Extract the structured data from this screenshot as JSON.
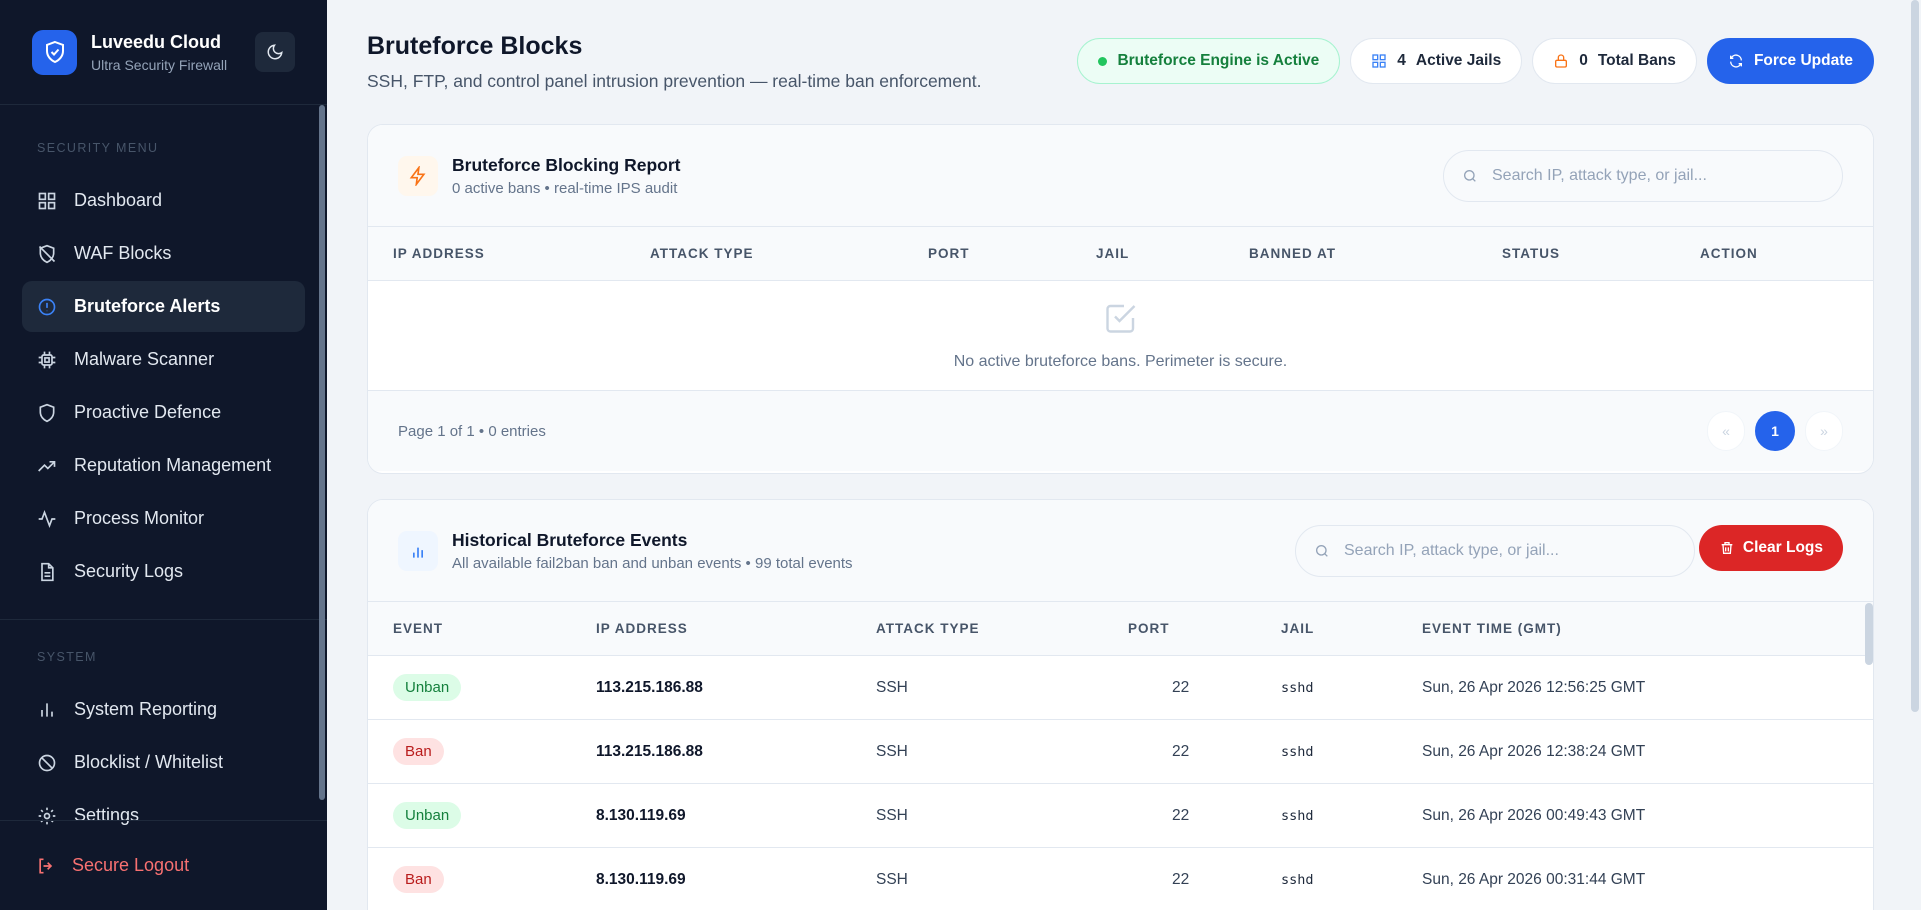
{
  "sidebar": {
    "brand_title": "Luveedu Cloud",
    "brand_sub": "Ultra Security Firewall",
    "security_label": "SECURITY MENU",
    "security_items": [
      {
        "label": "Dashboard",
        "icon": "grid-icon"
      },
      {
        "label": "WAF Blocks",
        "icon": "shield-off-icon"
      },
      {
        "label": "Bruteforce Alerts",
        "icon": "alert-circle-icon",
        "active": true
      },
      {
        "label": "Malware Scanner",
        "icon": "cpu-icon"
      },
      {
        "label": "Proactive Defence",
        "icon": "shield-icon"
      },
      {
        "label": "Reputation Management",
        "icon": "trending-up-icon"
      },
      {
        "label": "Process Monitor",
        "icon": "activity-icon"
      },
      {
        "label": "Security Logs",
        "icon": "file-text-icon"
      }
    ],
    "system_label": "SYSTEM",
    "system_items": [
      {
        "label": "System Reporting",
        "icon": "bar-chart-icon"
      },
      {
        "label": "Blocklist / Whitelist",
        "icon": "ban-icon"
      },
      {
        "label": "Settings",
        "icon": "gear-icon"
      }
    ],
    "logout_label": "Secure Logout"
  },
  "header": {
    "title": "Bruteforce Blocks",
    "subtitle": "SSH, FTP, and control panel intrusion prevention — real-time ban enforcement.",
    "engine_status": "Bruteforce Engine is Active",
    "active_jails_count": "4",
    "active_jails_label": "Active Jails",
    "total_bans_count": "0",
    "total_bans_label": "Total Bans",
    "force_update_label": "Force Update"
  },
  "report": {
    "title": "Bruteforce Blocking Report",
    "subtitle": "0 active bans • real-time IPS audit",
    "search_placeholder": "Search IP, attack type, or jail...",
    "columns": [
      "IP ADDRESS",
      "ATTACK TYPE",
      "PORT",
      "JAIL",
      "BANNED AT",
      "STATUS",
      "ACTION"
    ],
    "empty_text": "No active bruteforce bans. Perimeter is secure.",
    "footer_text": "Page 1 of 1 • 0 entries",
    "pager": {
      "prev": "«",
      "current": "1",
      "next": "»"
    }
  },
  "history": {
    "title": "Historical Bruteforce Events",
    "subtitle": "All available fail2ban ban and unban events • 99 total events",
    "search_placeholder": "Search IP, attack type, or jail...",
    "clear_label": "Clear Logs",
    "columns": [
      "EVENT",
      "IP ADDRESS",
      "ATTACK TYPE",
      "PORT",
      "JAIL",
      "EVENT TIME (GMT)"
    ],
    "rows": [
      {
        "event": "Unban",
        "ip": "113.215.186.88",
        "type": "SSH",
        "port": "22",
        "jail": "sshd",
        "time": "Sun, 26 Apr 2026 12:56:25 GMT"
      },
      {
        "event": "Ban",
        "ip": "113.215.186.88",
        "type": "SSH",
        "port": "22",
        "jail": "sshd",
        "time": "Sun, 26 Apr 2026 12:38:24 GMT"
      },
      {
        "event": "Unban",
        "ip": "8.130.119.69",
        "type": "SSH",
        "port": "22",
        "jail": "sshd",
        "time": "Sun, 26 Apr 2026 00:49:43 GMT"
      },
      {
        "event": "Ban",
        "ip": "8.130.119.69",
        "type": "SSH",
        "port": "22",
        "jail": "sshd",
        "time": "Sun, 26 Apr 2026 00:31:44 GMT"
      }
    ]
  },
  "colors": {
    "accent": "#2563eb",
    "sidebar_bg": "#0f172a",
    "danger": "#dc2626",
    "success": "#15803d"
  }
}
